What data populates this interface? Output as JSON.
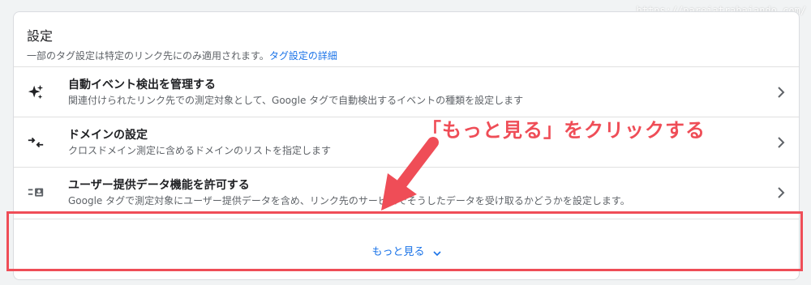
{
  "watermark": "https://parejatrabajando.com/",
  "section": {
    "title": "設定",
    "subtitle": "一部のタグ設定は特定のリンク先にのみ適用されます。",
    "details_link": "タグ設定の詳細"
  },
  "rows": [
    {
      "icon": "sparkle-icon",
      "label": "自動イベント検出を管理する",
      "description": "関連付けられたリンク先での測定対象として、Google タグで自動検出するイベントの種類を設定します"
    },
    {
      "icon": "arrows-inward-icon",
      "label": "ドメインの設定",
      "description": "クロスドメイン測定に含めるドメインのリストを指定します"
    },
    {
      "icon": "user-data-icon",
      "label": "ユーザー提供データ機能を許可する",
      "description": "Google タグで測定対象にユーザー提供データを含め、リンク先のサービスでそうしたデータを受け取るかどうかを設定します。"
    }
  ],
  "show_more": {
    "label": "もっと見る"
  },
  "annotation": {
    "text": "「もっと見る」をクリックする",
    "color": "#ef4d57"
  },
  "colors": {
    "link": "#1a73e8",
    "accent": "#ef4d57"
  }
}
